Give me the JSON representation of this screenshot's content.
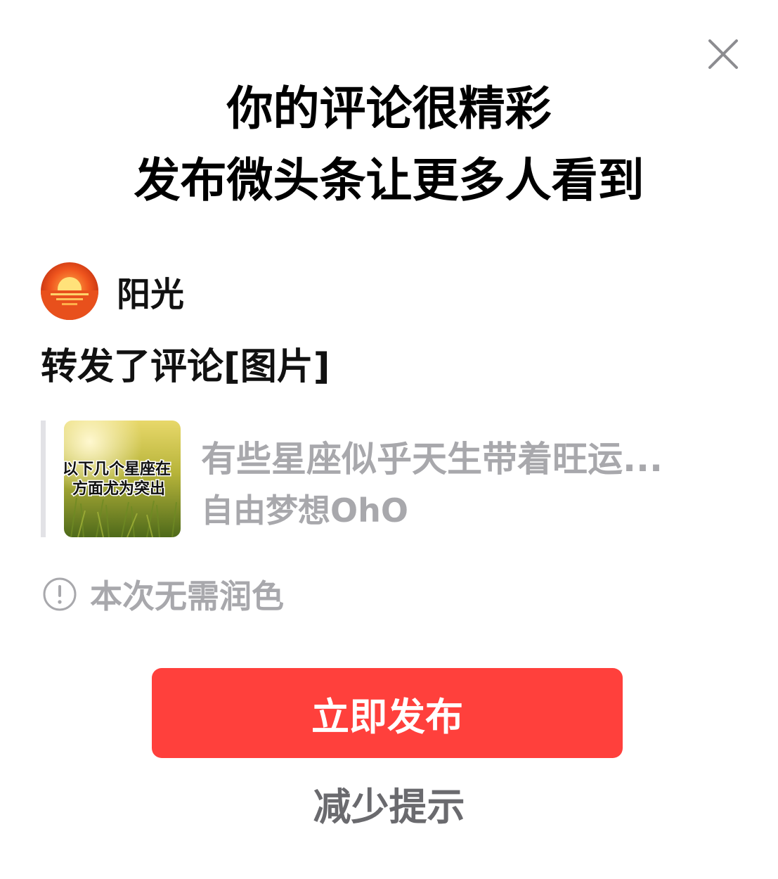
{
  "dialog": {
    "title_line1": "你的评论很精彩",
    "title_line2": "发布微头条让更多人看到",
    "close_icon": "close-icon"
  },
  "author": {
    "name": "阳光",
    "avatar_icon": "sunset-avatar"
  },
  "post": {
    "text": "转发了评论[图片]"
  },
  "quoted": {
    "thumbnail_caption_line1": "以下几个星座在",
    "thumbnail_caption_line2": "方面尤为突出",
    "title": "有些星座似乎天生带着旺运...",
    "author": "自由梦想OhO"
  },
  "notice": {
    "icon": "info-icon",
    "text": "本次无需润色"
  },
  "actions": {
    "publish_label": "立即发布",
    "reduce_label": "减少提示"
  },
  "colors": {
    "accent": "#ff403c",
    "muted_text": "#a8a8ac",
    "secondary_text": "#6a6a6e"
  }
}
